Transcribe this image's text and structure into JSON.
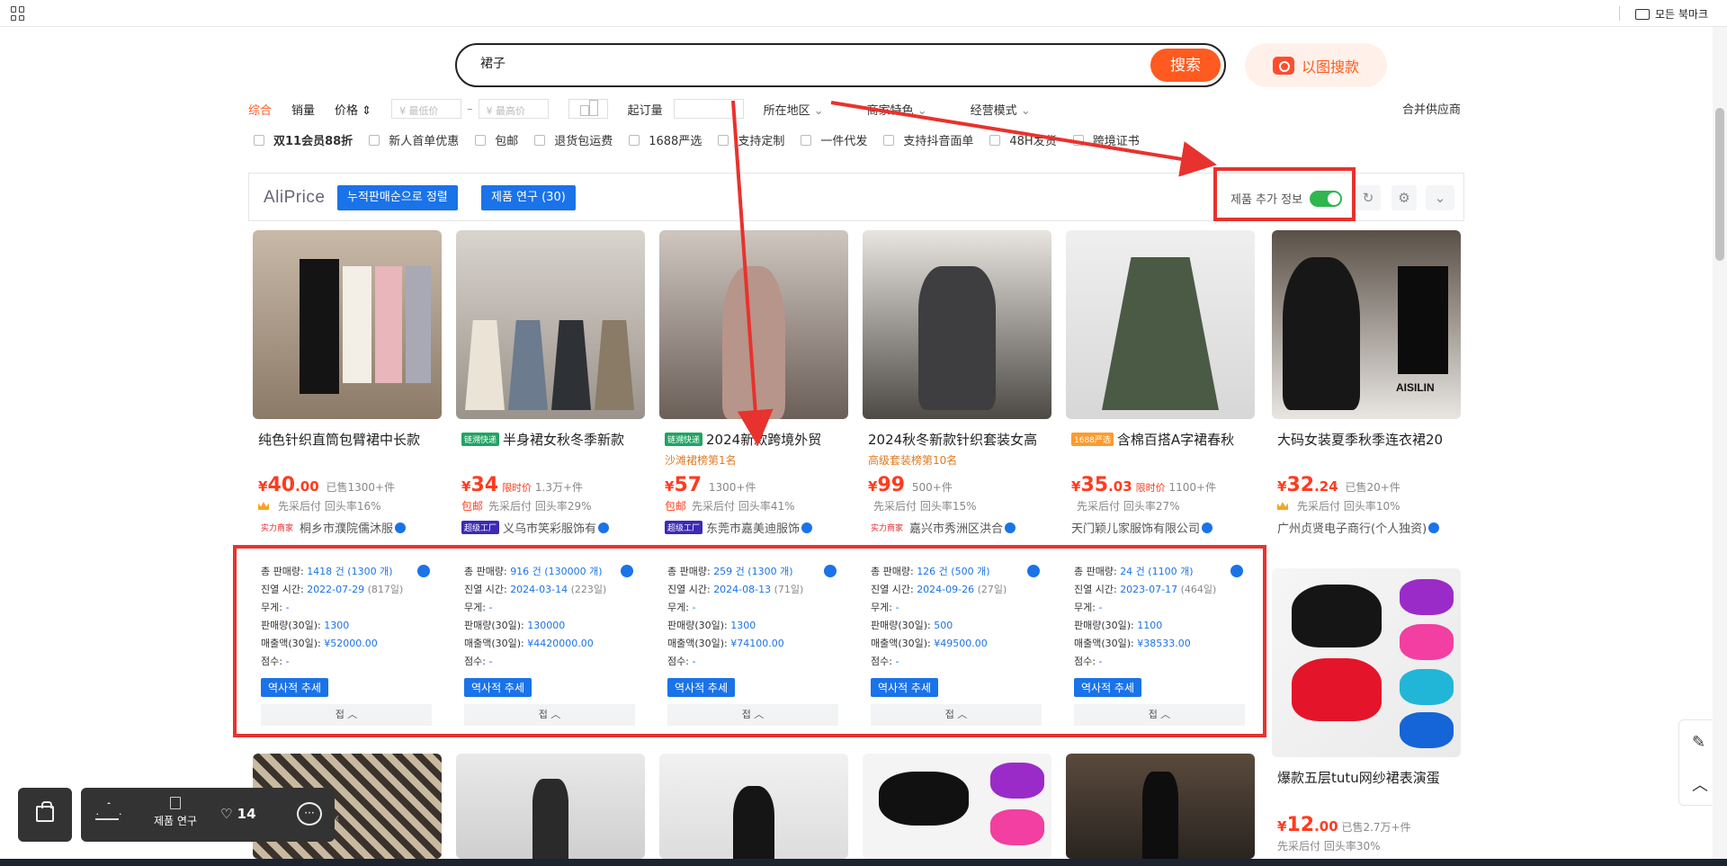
{
  "bookmarks": {
    "all_label": "모든 북마크"
  },
  "search": {
    "query": "裙子",
    "button": "搜索",
    "image_search": "以图搜款"
  },
  "sort": {
    "items": [
      "综合",
      "销量",
      "价格 ⇕"
    ],
    "min_price_ph": "¥ 最低价",
    "max_price_ph": "¥ 最高价",
    "moq": "起订量",
    "dropdowns": [
      "所在地区",
      "商家特色",
      "经营模式"
    ],
    "merge": "合并供应商"
  },
  "checks": [
    "双11会员88折",
    "新人首单优惠",
    "包邮",
    "退货包运费",
    "1688严选",
    "支持定制",
    "一件代发",
    "支持抖音面单",
    "48H发货",
    "跨境证书"
  ],
  "aliprice": {
    "logo": "AliPrice",
    "sort_button": "누적판매순으로 정렬",
    "research_button": "제품 연구 (30)",
    "extra_info": "제품 추가 정보",
    "refresh_icon": "↻",
    "settings_icon": "⚙",
    "chevron_icon": "⌄"
  },
  "products": [
    {
      "title": "纯色针织直筒包臂裙中长款",
      "tag": "",
      "rank": "",
      "price_int": "40",
      "price_dec": ".00",
      "limited": "",
      "sold": "已售1300+件",
      "meta_red": "",
      "meta": "先采后付   回头率16%",
      "crown": true,
      "seller_tag": "实力商家",
      "seller": "桐乡市濮院儒沐服"
    },
    {
      "title": "半身裙女秋冬季新款",
      "tag": "链溯快递",
      "rank": "",
      "price_int": "34",
      "price_dec": "",
      "limited": "限时价",
      "sold": "1.3万+件",
      "meta_red": "包邮",
      "meta": "先采后付   回头率29%",
      "crown": false,
      "seller_tag": "超级工厂",
      "seller": "义乌市笑彩服饰有"
    },
    {
      "title": "2024新款跨境外贸",
      "tag": "链溯快递",
      "rank": "沙滩裙榜第1名",
      "price_int": "57",
      "price_dec": "",
      "limited": "",
      "sold": "1300+件",
      "meta_red": "包邮",
      "meta": "先采后付   回头率41%",
      "crown": false,
      "seller_tag": "超级工厂",
      "seller": "东莞市嘉美迪服饰"
    },
    {
      "title": "2024秋冬新款针织套装女高",
      "tag": "",
      "rank": "高级套装榜第10名",
      "price_int": "99",
      "price_dec": "",
      "limited": "",
      "sold": "500+件",
      "meta_red": "",
      "meta": "先采后付   回头率15%",
      "crown": false,
      "seller_tag": "实力商家",
      "seller": "嘉兴市秀洲区洪合"
    },
    {
      "title": "含棉百搭A字裙春秋",
      "tag": "1688严选",
      "rank": "",
      "price_int": "35",
      "price_dec": ".03",
      "limited": "限时价",
      "sold": "1100+件",
      "meta_red": "",
      "meta": "先采后付   回头率27%",
      "crown": false,
      "seller_tag": "",
      "seller": "天门颖儿家服饰有限公司"
    },
    {
      "title": "大码女装夏季秋季连衣裙20",
      "tag": "",
      "rank": "",
      "price_int": "32",
      "price_dec": ".24",
      "limited": "",
      "sold": "已售20+件",
      "meta_red": "",
      "meta": "先采后付   回头率10%",
      "crown": true,
      "seller_tag": "",
      "seller": "广州贞贤电子商行(个人独资)"
    }
  ],
  "stats_labels": {
    "total": "총 판매량:",
    "listed": "진열 시간:",
    "weight": "무게:",
    "sales30": "판매량(30일):",
    "revenue30": "매출액(30일):",
    "score": "점수:",
    "history": "역사적 추세",
    "collapse": "접 ︿"
  },
  "stats": [
    {
      "total": "1418 건 (1300 개)",
      "listed": "2022-07-29",
      "days": "(817일)",
      "weight": "-",
      "sales30": "1300",
      "revenue30": "¥52000.00",
      "score": "-"
    },
    {
      "total": "916 건 (130000 개)",
      "listed": "2024-03-14",
      "days": "(223일)",
      "weight": "-",
      "sales30": "130000",
      "revenue30": "¥4420000.00",
      "score": "-"
    },
    {
      "total": "259 건 (1300 개)",
      "listed": "2024-08-13",
      "days": "(71일)",
      "weight": "-",
      "sales30": "1300",
      "revenue30": "¥74100.00",
      "score": "-"
    },
    {
      "total": "126 건 (500 개)",
      "listed": "2024-09-26",
      "days": "(27일)",
      "weight": "-",
      "sales30": "500",
      "revenue30": "¥49500.00",
      "score": "-"
    },
    {
      "total": "24 건 (1100 개)",
      "listed": "2023-07-17",
      "days": "(464일)",
      "weight": "-",
      "sales30": "1100",
      "revenue30": "¥38533.00",
      "score": "-"
    }
  ],
  "side_product": {
    "title": "爆款五层tutu网纱裙表演蛋",
    "price_int": "12",
    "price_dec": ".00",
    "sold": "已售2.7万+件",
    "meta": "先采后付   回头率30%"
  },
  "bottom_bar": {
    "research": "제품 연구",
    "heart_count": "♡ 14",
    "chat_icon": "···",
    "collapse_icon": "‹"
  },
  "right_widget": {
    "edit_icon": "✎",
    "up_icon": "︿"
  },
  "brand_on_image": "AISILIN",
  "colors": {
    "accent": "#ff5a1f",
    "blue": "#1a73e8",
    "annotation": "#e8322e",
    "toggle_on": "#2fb64f"
  }
}
